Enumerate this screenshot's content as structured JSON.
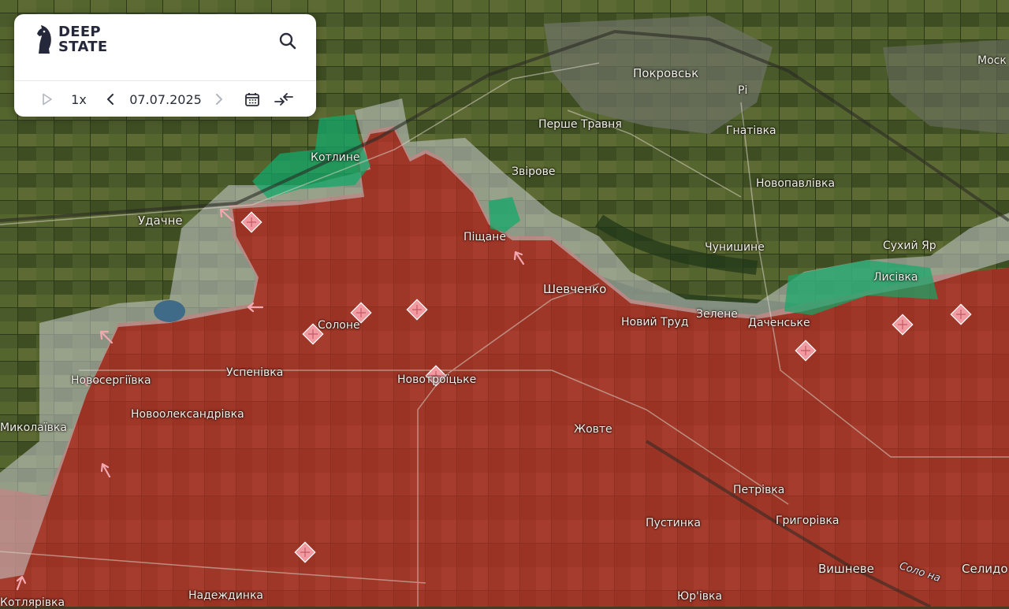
{
  "app": {
    "logo_line1": "DEEP",
    "logo_line2": "STATE"
  },
  "toolbar": {
    "play_icon": "play-icon",
    "speed": "1x",
    "date": "07.07.2025",
    "prev_icon": "chevron-left-icon",
    "next_icon": "chevron-right-icon",
    "calendar_icon": "calendar-icon",
    "compare_icon": "collapse-arrows-icon",
    "search_icon": "search-icon"
  },
  "map": {
    "colors": {
      "occupied": "#b4362a",
      "grey_zone": "#c8cdd0",
      "liberated": "#13a86a",
      "marker": "#f19aa2",
      "arrow": "#f3a8b0"
    },
    "places": {
      "pokrovsk": "Покровськ",
      "rig": "Рі",
      "pershe_travnia": "Перше Травня",
      "hnativka": "Гнатівка",
      "moskovske": "Моск",
      "kotlyne": "Котлине",
      "zvirove": "Звірове",
      "novopavlivka": "Новопавлівка",
      "udachne": "Удачне",
      "pishchane": "Піщане",
      "chunyshyne": "Чунишине",
      "sukhyi_yar": "Сухий Яр",
      "lysivka": "Лисівка",
      "shevchenko": "Шевченко",
      "novyi_trud": "Новий Труд",
      "zelene": "Зелене",
      "dachenske": "Даченське",
      "solone": "Солоне",
      "novoserhiivka": "Новосергіївка",
      "uspenivka": "Успенівка",
      "novotroitske": "Новотроїцьке",
      "novooleksandrivka": "Новоолександрівка",
      "mykolaivka": "Миколаївка",
      "zhovte": "Жовте",
      "petrivka": "Петрівка",
      "pustynka": "Пустинка",
      "hryhorivka": "Григорівка",
      "vyshneve": "Вишневе",
      "selydove": "Селидо",
      "solona_river": "Соло на",
      "nadezhdynka": "Надеждинка",
      "yurivka": "Юр'івка",
      "kotliarivka": "Котлярівка"
    }
  }
}
